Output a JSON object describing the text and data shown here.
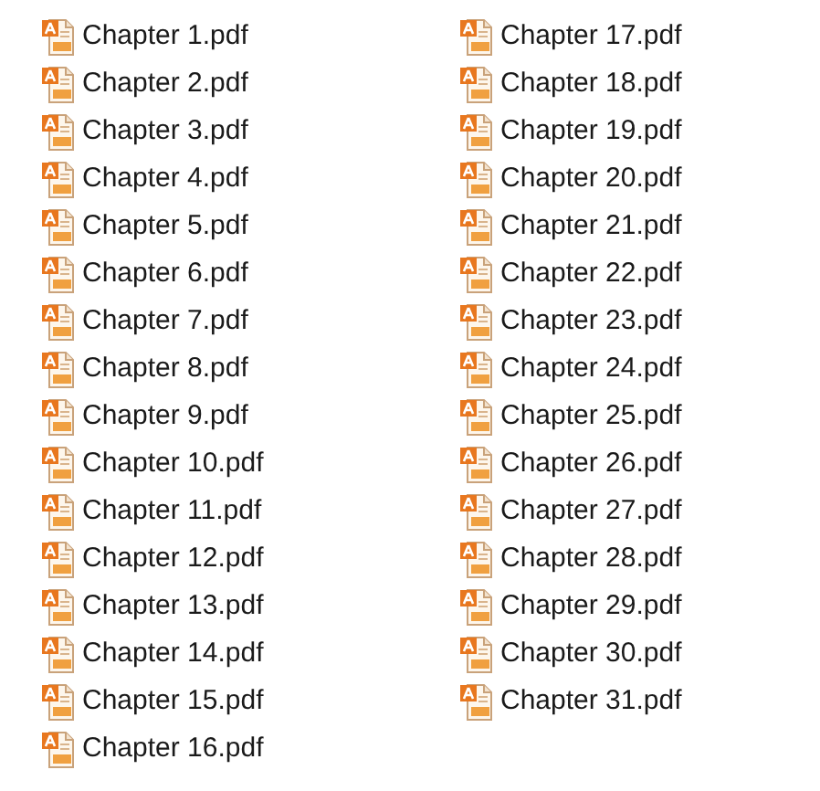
{
  "files": [
    {
      "name": "Chapter 1.pdf"
    },
    {
      "name": "Chapter 2.pdf"
    },
    {
      "name": "Chapter 3.pdf"
    },
    {
      "name": "Chapter 4.pdf"
    },
    {
      "name": "Chapter 5.pdf"
    },
    {
      "name": "Chapter 6.pdf"
    },
    {
      "name": "Chapter 7.pdf"
    },
    {
      "name": "Chapter 8.pdf"
    },
    {
      "name": "Chapter 9.pdf"
    },
    {
      "name": "Chapter 10.pdf"
    },
    {
      "name": "Chapter 11.pdf"
    },
    {
      "name": "Chapter 12.pdf"
    },
    {
      "name": "Chapter 13.pdf"
    },
    {
      "name": "Chapter 14.pdf"
    },
    {
      "name": "Chapter 15.pdf"
    },
    {
      "name": "Chapter 16.pdf"
    },
    {
      "name": "Chapter 17.pdf"
    },
    {
      "name": "Chapter 18.pdf"
    },
    {
      "name": "Chapter 19.pdf"
    },
    {
      "name": "Chapter 20.pdf"
    },
    {
      "name": "Chapter 21.pdf"
    },
    {
      "name": "Chapter 22.pdf"
    },
    {
      "name": "Chapter 23.pdf"
    },
    {
      "name": "Chapter 24.pdf"
    },
    {
      "name": "Chapter 25.pdf"
    },
    {
      "name": "Chapter 26.pdf"
    },
    {
      "name": "Chapter 27.pdf"
    },
    {
      "name": "Chapter 28.pdf"
    },
    {
      "name": "Chapter 29.pdf"
    },
    {
      "name": "Chapter 30.pdf"
    },
    {
      "name": "Chapter 31.pdf"
    }
  ]
}
